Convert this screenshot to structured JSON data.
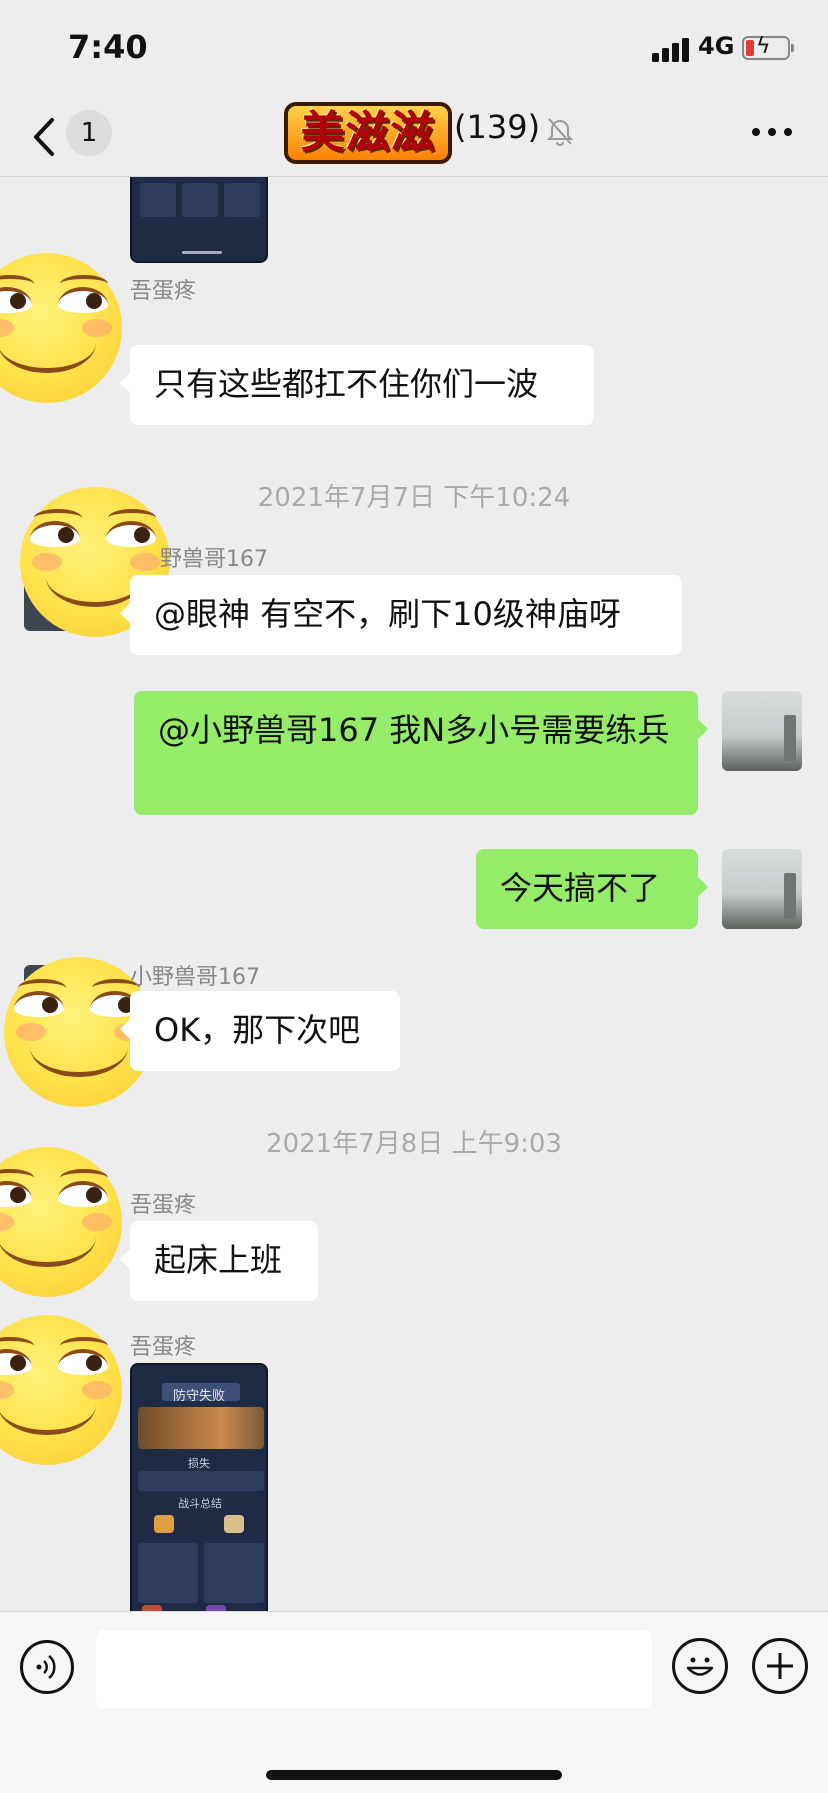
{
  "status_bar": {
    "time": "7:40",
    "network": "4G"
  },
  "nav": {
    "unread_count": "1",
    "group_logo_text": "美滋滋",
    "title_suffix": "(139)"
  },
  "messages": [
    {
      "type": "image",
      "side": "left",
      "sender_avatar": "emoji-face",
      "alt": "game-screenshot"
    },
    {
      "type": "text",
      "side": "left",
      "sender": "吾蛋疼",
      "text": "只有这些都扛不住你们一波"
    },
    {
      "type": "timestamp",
      "text": "2021年7月7日 下午10:24"
    },
    {
      "type": "text",
      "side": "left",
      "sender": "野兽哥167",
      "text": "@眼神 有空不，刷下10级神庙呀"
    },
    {
      "type": "text",
      "side": "right",
      "text": "@小野兽哥167 我N多小号需要练兵"
    },
    {
      "type": "text",
      "side": "right",
      "text": "今天搞不了"
    },
    {
      "type": "text",
      "side": "left",
      "sender": "小野兽哥167",
      "text": "OK，那下次吧"
    },
    {
      "type": "timestamp",
      "text": "2021年7月8日 上午9:03"
    },
    {
      "type": "text",
      "side": "left",
      "sender": "吾蛋疼",
      "text": "起床上班"
    },
    {
      "type": "image",
      "side": "left",
      "sender": "吾蛋疼",
      "image_title": "防守失败",
      "image_subtitle": "战斗总结",
      "image_loss": "损失"
    }
  ],
  "input": {
    "placeholder": ""
  }
}
